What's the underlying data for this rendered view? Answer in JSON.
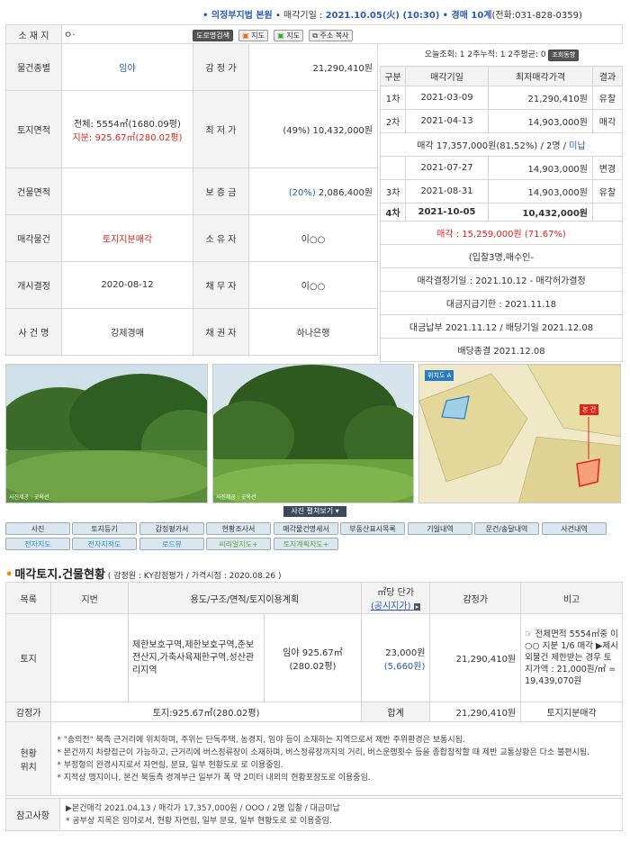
{
  "header": {
    "court": "• 의정부지법 본원",
    "sale_date_label": "• 매각기일 : ",
    "sale_date": "2021.10.05(火) (10:30)",
    "dept": "• 경매 10계",
    "phone": "(전화:031-828-0359)"
  },
  "info": {
    "address_label": "소 재 지",
    "address_value": "ㅇ·",
    "address_buttons": [
      "도로명검색",
      "지도",
      "지도",
      "주소 복사"
    ],
    "rows": [
      {
        "l1": "물건종별",
        "v1": "임야",
        "l2": "감 정 가",
        "v2": "21,290,410원"
      },
      {
        "l1": "토지면적",
        "v1a": "전체: 5554㎡(1680.09평)",
        "v1b": "지분: 925.67㎡(280.02평)",
        "l2": "최 저 가",
        "v2a": "(49%) ",
        "v2b": "10,432,000원"
      },
      {
        "l1": "건물면적",
        "v1": "",
        "l2": "보 증 금",
        "v2a": "(20%) ",
        "v2b": "2,086,400원"
      },
      {
        "l1": "매각물건",
        "v1": "토지지분매각",
        "l2": "소 유 자",
        "v2": "이○○"
      },
      {
        "l1": "개시결정",
        "v1": "2020-08-12",
        "l2": "채 무 자",
        "v2": "이○○"
      },
      {
        "l1": "사 건 명",
        "v1": "강제경매",
        "l2": "채 권 자",
        "v2": "하나은행"
      }
    ]
  },
  "stats": {
    "text": "오늘조회: 1  2주누적: 1  2주평균: 0",
    "trend_btn": "조회동향"
  },
  "history": {
    "headers": [
      "구분",
      "매각기일",
      "최저매각가격",
      "결과"
    ],
    "rows": [
      {
        "round": "1차",
        "date": "2021-03-09",
        "price": "21,290,410원",
        "result": "유찰"
      },
      {
        "round": "2차",
        "date": "2021-04-13",
        "price": "14,903,000원",
        "result": "매각"
      }
    ],
    "sale_note_a": "매각 17,357,000원(81.52%) / 2명 / ",
    "sale_note_b": "미납",
    "rows2": [
      {
        "round": "",
        "date": "2021-07-27",
        "price": "14,903,000원",
        "result": "변경"
      },
      {
        "round": "3차",
        "date": "2021-08-31",
        "price": "14,903,000원",
        "result": "유찰"
      },
      {
        "round": "4차",
        "date": "2021-10-05",
        "price": "10,432,000원",
        "result": ""
      }
    ],
    "final_sale": "매각 : 15,259,000원  (71.67%)",
    "bidders": "(입찰3명,매수인-",
    "decision": "매각결정기일 : 2021.10.12 - 매각허가결정",
    "deadline": "대금지급기한 : 2021.11.18",
    "payment": "대금납부 2021.11.12 / 배당기일 2021.12.08",
    "dividend_end": "배당종결 2021.12.08"
  },
  "photos": {
    "caption1": "사진제공 : 굿옥션",
    "caption2": "사진제공 : 굿옥션",
    "map_label1": "위치도 A",
    "map_label2": "본 건",
    "expand_btn": "사진 펼쳐보기"
  },
  "tabs": {
    "row1": [
      "사진",
      "토지등기",
      "감정평가서",
      "현황조사서",
      "매각물건명세서",
      "부동산표시목록",
      "기일내역",
      "문건/송달내역",
      "사건내역"
    ],
    "row2": [
      "전자지도",
      "전자지적도",
      "로드뷰",
      "씨리얼지도+",
      "토지계획지도+"
    ]
  },
  "section": {
    "title": "매각토지.건물현황",
    "sub": " ( 감정원 : KY감정평가 / 가격시점 : 2020.08.26 )"
  },
  "land": {
    "headers": [
      "목록",
      "지번",
      "용도/구조/면적/토지이용계획",
      "㎡당 단가",
      "(공시지가)",
      "감정가",
      "비고"
    ],
    "row_label": "토지",
    "usage": "제한보호구역,제한보호구역,준보전산지,가축사육제한구역,성산관리지역",
    "area_a": "임야 925.67㎡",
    "area_b": "(280.02평)",
    "unit_price": "23,000원",
    "public_price": "(5,660원)",
    "appraisal": "21,290,410원",
    "remark": "☞ 전체면적 5554㎡중 이○○ 지분 1/6 매각 ▶제시외물건 제한받는 경우 토지가액 : 21,000원/㎡ = 19,439,070원",
    "sum_label": "감정가",
    "sum_area": "토지:925.67㎡(280.02평)",
    "sum_total_label": "합계",
    "sum_total": "21,290,410원",
    "sum_remark": "토지지분매각",
    "status_label": "현황\n위치",
    "status_lines": [
      "* \"송의전\" 북측 근거리에 위치하며, 주위는 단독주택, 농경지, 임야 등이 소재하는 지역으로서 제반 주위환경은 보통시됨.",
      "* 본건까지 차량접근이 가능하고, 근거리에 버스정류장이 소재하며, 버스정류장까지의 거리, 버스운행횟수 등을 종합참작할 때 제반 교통상황은 다소 불편시됨.",
      "* 부정형의 완경사지로서 자연림, 분묘, 일부 현황도로 로 이용중임.",
      "* 지적상 맹지이나, 본건 북동측 경계부근 일부가 폭 약 2미터 내외의 현황포장도로 이용중임."
    ],
    "ref_label": "참고사항",
    "ref_lines": [
      "▶본건매각 2021.04.13 / 매각가 17,357,000원 / OOO / 2명 입찰 / 대금미납",
      "* 공부상 지목은 임야로서, 현황 자연림, 일부 분묘, 일부 현황도로 로 이용중임."
    ]
  }
}
